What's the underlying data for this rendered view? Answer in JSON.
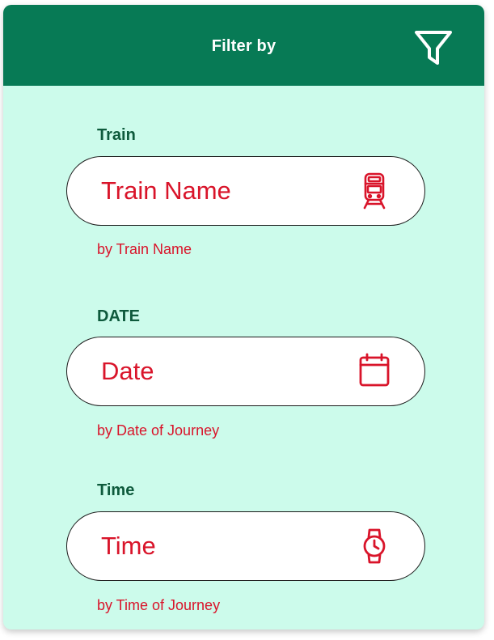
{
  "header": {
    "title": "Filter by",
    "icon": "filter-icon"
  },
  "colors": {
    "header_bg": "#077a55",
    "panel_bg": "#ccfbeb",
    "accent_red": "#d9142a",
    "label_green": "#0e5a3c"
  },
  "sections": [
    {
      "label": "Train",
      "placeholder": "Train Name",
      "hint": "by Train Name",
      "icon": "train-icon"
    },
    {
      "label": "DATE",
      "placeholder": "Date",
      "hint": "by Date of Journey",
      "icon": "calendar-icon"
    },
    {
      "label": "Time",
      "placeholder": "Time",
      "hint": "by Time of Journey",
      "icon": "watch-icon"
    }
  ]
}
